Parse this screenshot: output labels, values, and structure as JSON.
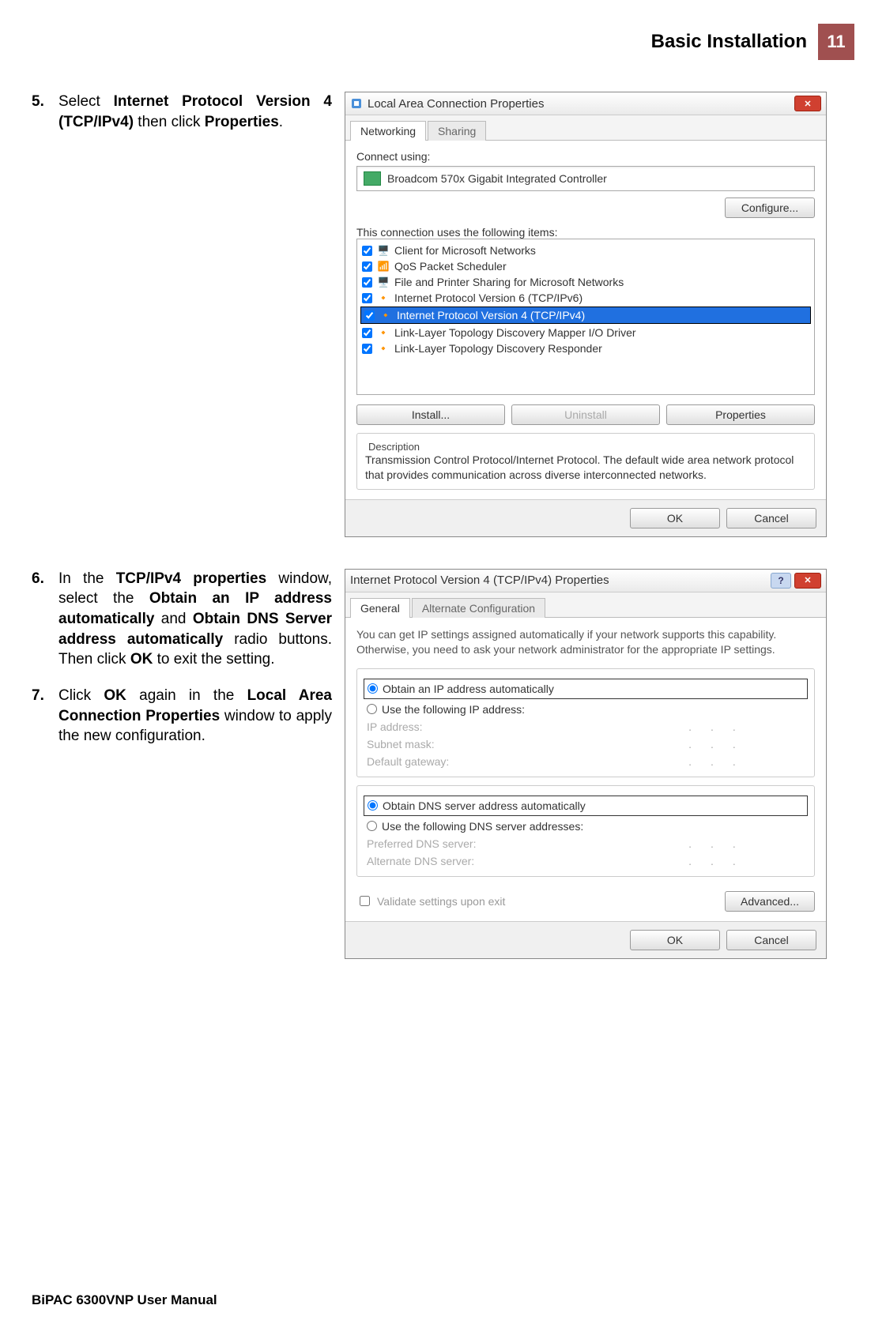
{
  "header": {
    "title": "Basic Installation",
    "page_num": "11"
  },
  "footer": "BiPAC 6300VNP User Manual",
  "steps": {
    "s5": {
      "num": "5.",
      "pre": "Select ",
      "b1": "Internet Protocol Version 4 (TCP/IPv4)",
      "mid": " then click ",
      "b2": "Properties",
      "post": "."
    },
    "s6": {
      "num": "6.",
      "pre": "In the ",
      "b1": "TCP/IPv4 properties",
      "t1": " window, select the ",
      "b2": "Obtain an IP address automatically",
      "t2": " and ",
      "b3": "Obtain DNS Server address automatically",
      "t3": " radio buttons. Then click ",
      "b4": "OK",
      "t4": " to exit the setting."
    },
    "s7": {
      "num": "7.",
      "pre": "Click ",
      "b1": "OK",
      "t1": " again in the ",
      "b2": "Local Area Connection Properties",
      "t2": " window to apply the new configuration."
    }
  },
  "d1": {
    "title": "Local Area Connection Properties",
    "tabs": {
      "networking": "Networking",
      "sharing": "Sharing"
    },
    "connect_label": "Connect using:",
    "adapter": "Broadcom 570x Gigabit Integrated Controller",
    "configure": "Configure...",
    "items_label": "This connection uses the following items:",
    "items": [
      "Client for Microsoft Networks",
      "QoS Packet Scheduler",
      "File and Printer Sharing for Microsoft Networks",
      "Internet Protocol Version 6 (TCP/IPv6)",
      "Internet Protocol Version 4 (TCP/IPv4)",
      "Link-Layer Topology Discovery Mapper I/O Driver",
      "Link-Layer Topology Discovery Responder"
    ],
    "install": "Install...",
    "uninstall": "Uninstall",
    "properties": "Properties",
    "desc_label": "Description",
    "desc": "Transmission Control Protocol/Internet Protocol. The default wide area network protocol that provides communication across diverse interconnected networks.",
    "ok": "OK",
    "cancel": "Cancel"
  },
  "d2": {
    "title": "Internet Protocol Version 4 (TCP/IPv4) Properties",
    "tabs": {
      "general": "General",
      "alt": "Alternate Configuration"
    },
    "intro": "You can get IP settings assigned automatically if your network supports this capability. Otherwise, you need to ask your network administrator for the appropriate IP settings.",
    "r1": "Obtain an IP address automatically",
    "r2": "Use the following IP address:",
    "ip_label": "IP address:",
    "mask_label": "Subnet mask:",
    "gw_label": "Default gateway:",
    "r3": "Obtain DNS server address automatically",
    "r4": "Use the following DNS server addresses:",
    "pdns": "Preferred DNS server:",
    "adns": "Alternate DNS server:",
    "validate": "Validate settings upon exit",
    "advanced": "Advanced...",
    "ok": "OK",
    "cancel": "Cancel"
  }
}
